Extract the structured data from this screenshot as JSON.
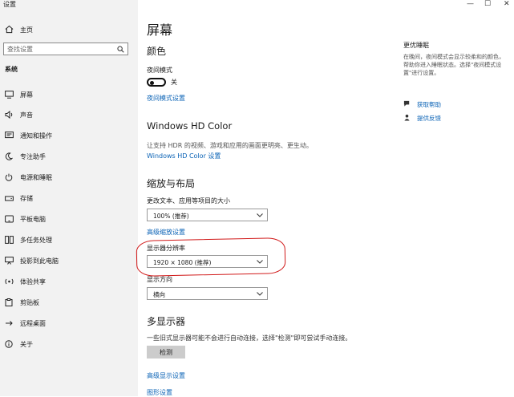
{
  "window": {
    "title": "设置",
    "minimize": "—",
    "maximize": "☐",
    "close": "✕"
  },
  "sidebar": {
    "home": "主页",
    "search_placeholder": "查找设置",
    "section": "系统",
    "items": [
      {
        "label": "屏幕",
        "icon": "monitor-icon"
      },
      {
        "label": "声音",
        "icon": "speaker-icon"
      },
      {
        "label": "通知和操作",
        "icon": "notification-icon"
      },
      {
        "label": "专注助手",
        "icon": "moon-icon"
      },
      {
        "label": "电源和睡眠",
        "icon": "power-icon"
      },
      {
        "label": "存储",
        "icon": "storage-icon"
      },
      {
        "label": "平板电脑",
        "icon": "tablet-icon"
      },
      {
        "label": "多任务处理",
        "icon": "multitask-icon"
      },
      {
        "label": "投影到此电脑",
        "icon": "projector-icon"
      },
      {
        "label": "体验共享",
        "icon": "share-icon"
      },
      {
        "label": "剪贴板",
        "icon": "clipboard-icon"
      },
      {
        "label": "远程桌面",
        "icon": "remote-desktop-icon"
      },
      {
        "label": "关于",
        "icon": "info-icon"
      }
    ]
  },
  "main": {
    "title": "屏幕",
    "color": {
      "heading": "颜色",
      "night_label": "夜间模式",
      "night_state": "关",
      "night_link": "夜间模式设置"
    },
    "hdr": {
      "heading": "Windows HD Color",
      "desc": "让支持 HDR 的视频、游戏和应用的画面更明亮、更生动。",
      "link": "Windows HD Color 设置"
    },
    "scale": {
      "heading": "缩放与布局",
      "scale_label": "更改文本、应用等项目的大小",
      "scale_value": "100% (推荐)",
      "adv_link": "高级缩放设置",
      "res_label": "显示器分辨率",
      "res_value": "1920 × 1080 (推荐)",
      "orient_label": "显示方向",
      "orient_value": "横向"
    },
    "multi": {
      "heading": "多显示器",
      "desc": "一些旧式显示器可能不会进行自动连接，选择\"检测\"即可尝试手动连接。",
      "detect": "检测",
      "adv_link": "高级显示设置",
      "graphics_link": "图形设置"
    }
  },
  "right_panel": {
    "title": "更优睡眠",
    "desc": "在晚间，夜间模式会显示较柔和的颜色，帮助你进入睡眠状态。选择\"夜间模式设置\"进行设置。",
    "help": "获取帮助",
    "feedback": "提供反馈"
  }
}
